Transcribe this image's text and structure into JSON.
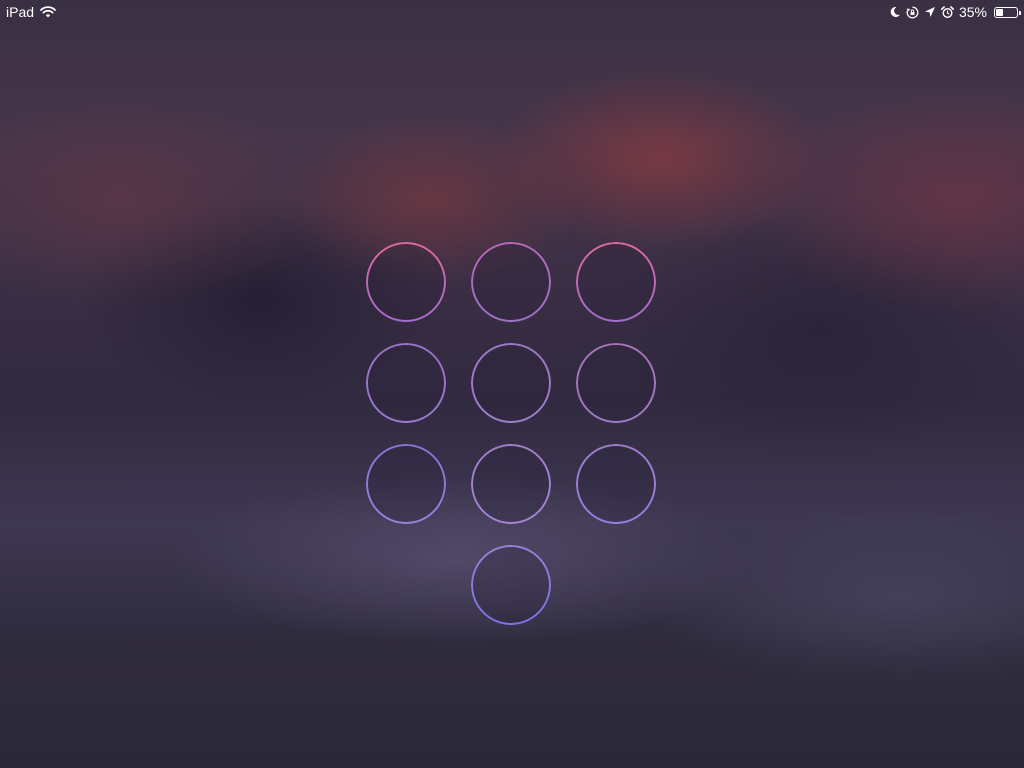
{
  "status_bar": {
    "device": "iPad",
    "battery_text": "35%",
    "battery_level": 0.35,
    "icons": [
      "wifi-icon",
      "moon-icon",
      "rotation-lock-icon",
      "location-arrow-icon",
      "alarm-icon",
      "battery-icon"
    ]
  },
  "keypad": {
    "keys": [
      {
        "id": "1",
        "color_top": "#e06a9c",
        "color_bottom": "#a46cd0"
      },
      {
        "id": "2",
        "color_top": "#b76ab8",
        "color_bottom": "#9c72c8"
      },
      {
        "id": "3",
        "color_top": "#e06a9c",
        "color_bottom": "#a46cd0"
      },
      {
        "id": "4",
        "color_top": "#9a72c6",
        "color_bottom": "#9a7ad0"
      },
      {
        "id": "5",
        "color_top": "#9e78c8",
        "color_bottom": "#a07ed0"
      },
      {
        "id": "6",
        "color_top": "#a874b8",
        "color_bottom": "#a07ac8"
      },
      {
        "id": "7",
        "color_top": "#8b72d6",
        "color_bottom": "#9a80dc"
      },
      {
        "id": "8",
        "color_top": "#a27ece",
        "color_bottom": "#a684d6"
      },
      {
        "id": "9",
        "color_top": "#a07ed0",
        "color_bottom": "#9a7ee0"
      },
      {
        "id": "0",
        "color_top": "#9b82d8",
        "color_bottom": "#8070e6"
      }
    ]
  }
}
